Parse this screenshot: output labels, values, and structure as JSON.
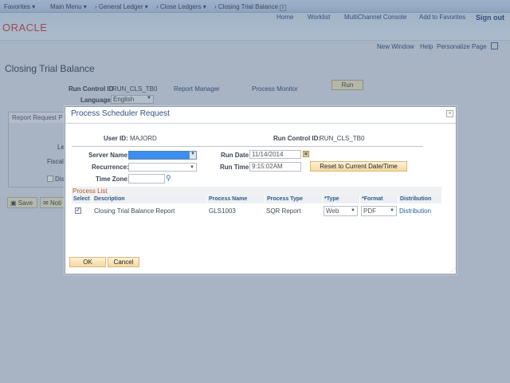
{
  "topnav": {
    "favorites": "Favorites",
    "main_menu": "Main Menu",
    "general_ledger": "General Ledger",
    "close_ledgers": "Close Ledgers",
    "current": "Closing Trial Balance"
  },
  "header": {
    "logo": "ORACLE",
    "links": [
      "Home",
      "Worklist",
      "MultiChannel Console",
      "Add to Favorites",
      "Sign out"
    ]
  },
  "pagebar": {
    "new_window": "New Window",
    "help": "Help",
    "personalize": "Personalize Page"
  },
  "page": {
    "title": "Closing Trial Balance",
    "run_control_label": "Run Control ID",
    "run_control_value": "RUN_CLS_TB0",
    "report_manager": "Report Manager",
    "process_monitor": "Process Monitor",
    "run_button": "Run",
    "language_label": "Language",
    "language_value": "English",
    "group_title": "Report Request P",
    "field_le": "Le",
    "field_fiscal": "Fiscal",
    "checkbox_dis": "Dis",
    "save_button": "Save",
    "notify_button": "Noti"
  },
  "dialog": {
    "title": "Process Scheduler Request",
    "user_id_label": "User ID:",
    "user_id": "MAJORD",
    "run_control_label": "Run Control ID:",
    "run_control": "RUN_CLS_TB0",
    "server_name_label": "Server Name:",
    "server_name": "",
    "recurrence_label": "Recurrence:",
    "recurrence": "",
    "time_zone_label": "Time Zone:",
    "time_zone": "",
    "run_date_label": "Run Date:",
    "run_date": "11/14/2014",
    "run_time_label": "Run Time:",
    "run_time": "9:15:02AM",
    "reset_button": "Reset to Current Date/Time",
    "process_list_title": "Process List",
    "columns": [
      "Select",
      "Description",
      "Process Name",
      "Process Type",
      "*Type",
      "*Format",
      "Distribution"
    ],
    "rows": [
      {
        "selected": true,
        "description": "Closing Trial Balance Report",
        "process_name": "GLS1003",
        "process_type": "SQR Report",
        "type": "Web",
        "format": "PDF",
        "distribution": "Distribution"
      }
    ],
    "ok": "OK",
    "cancel": "Cancel",
    "close": "×"
  }
}
